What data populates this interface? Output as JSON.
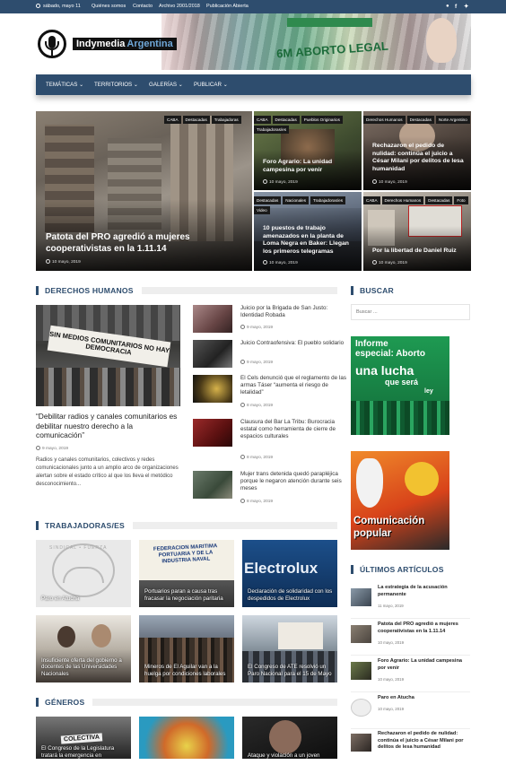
{
  "topbar": {
    "date": "sábado, mayo 11",
    "links": [
      "Quiénes somos",
      "Contacto",
      "Archivo 2001/2018",
      "Publicación Abierta"
    ],
    "social": [
      "reddit-icon",
      "facebook-icon",
      "twitter-icon"
    ]
  },
  "header": {
    "logo_text_1": "Indymedia",
    "logo_text_2": "Argentina",
    "banner_text": "6M ABORTO LEGAL"
  },
  "nav": {
    "items": [
      "TEMÁTICAS",
      "TERRITORIOS",
      "GALERÍAS",
      "PUBLICAR"
    ]
  },
  "featured": [
    {
      "tags": [
        "CABA",
        "Destacadas",
        "Trabajadoras"
      ],
      "title": "Patota del PRO agredió a mujeres cooperativistas en la 1.11.14",
      "date": "10 mayo, 2019"
    },
    {
      "tags": [
        "CABA",
        "Destacadas",
        "Pueblos Originarios",
        "Trabajadoras/es"
      ],
      "title": "Foro Agrario: La unidad campesina por venir",
      "date": "10 mayo, 2019"
    },
    {
      "tags": [
        "Derechos Humanos",
        "Destacadas",
        "Norte Argentino"
      ],
      "title": "Rechazaron el pedido de nulidad: continúa el juicio a César Milani por delitos de lesa humanidad",
      "date": "10 mayo, 2019"
    },
    {
      "tags": [
        "Destacadas",
        "Nacionales",
        "Trabajadoras/es",
        "Video"
      ],
      "title": "10 puestos de trabajo amenazados en la planta de Loma Negra en Baker: Llegan los primeros telegramas",
      "date": "10 mayo, 2019"
    },
    {
      "tags": [
        "CABA",
        "Derechos Humanos",
        "Destacadas",
        "Foto"
      ],
      "title": "Por la libertad de Daniel Ruiz",
      "date": "10 mayo, 2019"
    }
  ],
  "ddhh": {
    "heading": "DERECHOS HUMANOS",
    "main": {
      "banner": "SIN MEDIOS COMUNITARIOS NO HAY DEMOCRACIA",
      "title": "“Debilitar radios y canales comunitarios es debilitar nuestro derecho a la comunicación”",
      "date": "9 mayo, 2019",
      "excerpt": "Radios y canales comunitarios, colectivos y redes comunicacionales junto a un amplio arco de organizaciones alertan sobre el estado crítico al que los lleva el metódico desconocimiento..."
    },
    "list": [
      {
        "title": "Juicio por la Brigada de San Justo: Identidad Robada",
        "date": "9 mayo, 2019"
      },
      {
        "title": "Juicio Contraofensiva: El pueblo solidario",
        "date": "9 mayo, 2019"
      },
      {
        "title": "El Cels denunció que el reglamento de las armas Táser “aumenta el riesgo de letalidad”",
        "date": "8 mayo, 2019"
      },
      {
        "title": "Clausura del Bar La Tribu: Burocracia estatal como herramienta de cierre de espacios culturales",
        "date": "8 mayo, 2019"
      },
      {
        "title": "Mujer trans detenida quedó parapléjica porque le negaron atención durante seis meses",
        "date": "8 mayo, 2019"
      }
    ]
  },
  "trab": {
    "heading": "TRABAJADORAS/ES",
    "tiles": [
      {
        "title": "Paro en Atucha",
        "img_text": "SINDICAL • FUERZA"
      },
      {
        "title": "Portuarios paran a causa tras fracasar la negociación paritaria",
        "img_text": "FEDERACION MARITIMA PORTUARIA Y DE LA INDUSTRIA NAVAL"
      },
      {
        "title": "Declaración de solidaridad con los despedidos de Electrolux",
        "img_text": "Electrolux"
      },
      {
        "title": "Insuficiente oferta del gobierno a docentes de las Universidades Nacionales",
        "img_text": ""
      },
      {
        "title": "Mineros de El Aguilar van a la huelga por condiciones laborales",
        "img_text": ""
      },
      {
        "title": "El Congreso de ATE resolvió un Paro Nacional para el 15 de Mayo",
        "img_text": ""
      }
    ]
  },
  "generos": {
    "heading": "GÉNEROS",
    "tiles": [
      {
        "title": "El Congreso de la Legislatura tratará la emergencia en",
        "img_text": "COLECTIVA"
      },
      {
        "title": "",
        "img_text": ""
      },
      {
        "title": "Ataque y violación a un joven",
        "img_text": ""
      }
    ]
  },
  "sidebar": {
    "buscar_heading": "BUSCAR",
    "search_placeholder": "Buscar ...",
    "promo1": {
      "line1": "Informe",
      "line2": "especial: Aborto",
      "line3": "una lucha",
      "line4": "que será",
      "line5": "ley"
    },
    "promo2": {
      "line1": "Comunicación",
      "line2": "popular"
    },
    "latest_heading": "ÚLTIMOS ARTÍCULOS",
    "latest": [
      {
        "title": "La estrategia de la acusación permanente",
        "date": "11 mayo, 2019"
      },
      {
        "title": "Patota del PRO agredió a mujeres cooperativistas en la 1.11.14",
        "date": "10 mayo, 2019"
      },
      {
        "title": "Foro Agrario: La unidad campesina por venir",
        "date": "10 mayo, 2019"
      },
      {
        "title": "Paro en Atucha",
        "date": "10 mayo, 2019"
      },
      {
        "title": "Rechazaron el pedido de nulidad: continúa el juicio a César Milani por delitos de lesa humanidad",
        "date": ""
      }
    ]
  },
  "colors": {
    "brand": "#2e4d6e",
    "green": "#1a8f4a",
    "orange": "#e35d1f"
  }
}
